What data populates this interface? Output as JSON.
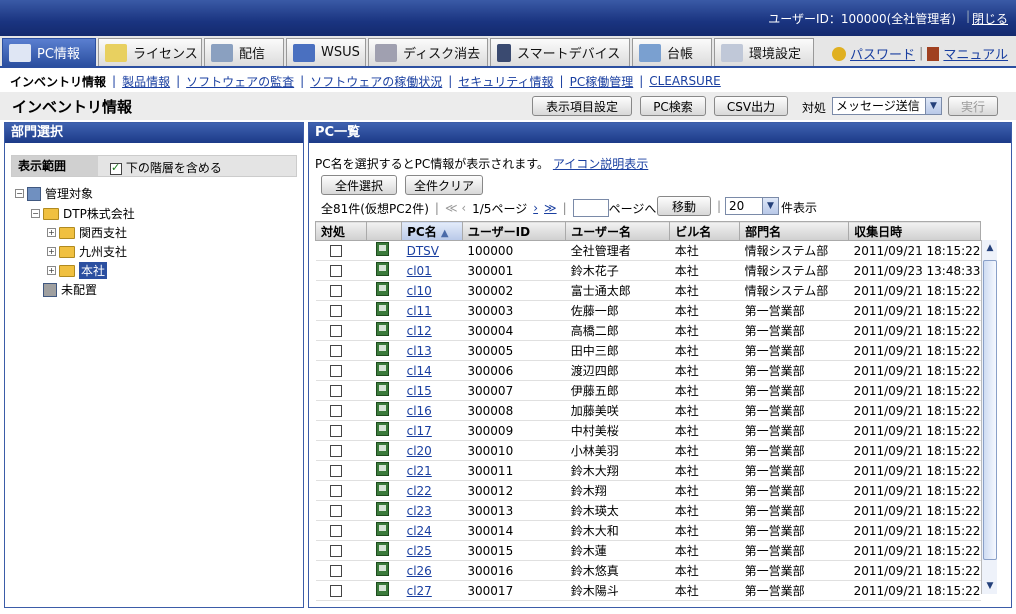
{
  "header": {
    "user": "ユーザーID：100000(全社管理者)",
    "logout": "閉じる"
  },
  "tabs": [
    {
      "label": "PC情報",
      "icon": "pc-info-icon"
    },
    {
      "label": "ライセンス",
      "icon": "license-icon"
    },
    {
      "label": "配信",
      "icon": "distribution-icon"
    },
    {
      "label": "WSUS",
      "icon": "wsus-icon"
    },
    {
      "label": "ディスク消去",
      "icon": "disk-erase-icon"
    },
    {
      "label": "スマートデバイス",
      "icon": "smart-device-icon"
    },
    {
      "label": "台帳",
      "icon": "ledger-icon"
    },
    {
      "label": "環境設定",
      "icon": "settings-icon"
    }
  ],
  "toplinks": {
    "password": "パスワード",
    "manual": "マニュアル"
  },
  "subnav": {
    "current": "インベントリ情報",
    "links": [
      "製品情報",
      "ソフトウェアの監査",
      "ソフトウェアの稼働状況",
      "セキュリティ情報",
      "PC稼働管理",
      "CLEARSURE"
    ]
  },
  "page": {
    "title": "インベントリ情報",
    "btn_columns": "表示項目設定",
    "btn_search": "PC検索",
    "btn_csv": "CSV出力",
    "action_label": "対処",
    "action_value": "メッセージ送信",
    "btn_exec": "実行"
  },
  "left": {
    "title": "部門選択",
    "scope_label": "表示範囲",
    "include_sub": "下の階層を含める",
    "tree": {
      "root": "管理対象",
      "company": "DTP株式会社",
      "branches": [
        "関西支社",
        "九州支社",
        "本社"
      ],
      "unassigned": "未配置"
    }
  },
  "right": {
    "title": "PC一覧",
    "info": "PC名を選択するとPC情報が表示されます。",
    "icon_help": "アイコン説明表示",
    "btn_select_all": "全件選択",
    "btn_clear_all": "全件クリア",
    "count": "全81件(仮想PC2件)",
    "pager": "1/5ページ",
    "page_goto_suffix": "ページへ",
    "btn_move": "移動",
    "per_page": "20",
    "per_page_suffix": "件表示",
    "columns": [
      "対処",
      "",
      "PC名",
      "ユーザーID",
      "ユーザー名",
      "ビル名",
      "部門名",
      "収集日時"
    ],
    "rows": [
      {
        "pc": "DTSV",
        "uid": "100000",
        "uname": "全社管理者",
        "bldg": "本社",
        "dept": "情報システム部",
        "date": "2011/09/21 18:15:22"
      },
      {
        "pc": "cl01",
        "uid": "300001",
        "uname": "鈴木花子",
        "bldg": "本社",
        "dept": "情報システム部",
        "date": "2011/09/23 13:48:33"
      },
      {
        "pc": "cl10",
        "uid": "300002",
        "uname": "富士通太郎",
        "bldg": "本社",
        "dept": "情報システム部",
        "date": "2011/09/21 18:15:22"
      },
      {
        "pc": "cl11",
        "uid": "300003",
        "uname": "佐藤一郎",
        "bldg": "本社",
        "dept": "第一営業部",
        "date": "2011/09/21 18:15:22"
      },
      {
        "pc": "cl12",
        "uid": "300004",
        "uname": "高橋二郎",
        "bldg": "本社",
        "dept": "第一営業部",
        "date": "2011/09/21 18:15:22"
      },
      {
        "pc": "cl13",
        "uid": "300005",
        "uname": "田中三郎",
        "bldg": "本社",
        "dept": "第一営業部",
        "date": "2011/09/21 18:15:22"
      },
      {
        "pc": "cl14",
        "uid": "300006",
        "uname": "渡辺四郎",
        "bldg": "本社",
        "dept": "第一営業部",
        "date": "2011/09/21 18:15:22"
      },
      {
        "pc": "cl15",
        "uid": "300007",
        "uname": "伊藤五郎",
        "bldg": "本社",
        "dept": "第一営業部",
        "date": "2011/09/21 18:15:22"
      },
      {
        "pc": "cl16",
        "uid": "300008",
        "uname": "加藤美咲",
        "bldg": "本社",
        "dept": "第一営業部",
        "date": "2011/09/21 18:15:22"
      },
      {
        "pc": "cl17",
        "uid": "300009",
        "uname": "中村美桜",
        "bldg": "本社",
        "dept": "第一営業部",
        "date": "2011/09/21 18:15:22"
      },
      {
        "pc": "cl20",
        "uid": "300010",
        "uname": "小林美羽",
        "bldg": "本社",
        "dept": "第一営業部",
        "date": "2011/09/21 18:15:22"
      },
      {
        "pc": "cl21",
        "uid": "300011",
        "uname": "鈴木大翔",
        "bldg": "本社",
        "dept": "第一営業部",
        "date": "2011/09/21 18:15:22"
      },
      {
        "pc": "cl22",
        "uid": "300012",
        "uname": "鈴木翔",
        "bldg": "本社",
        "dept": "第一営業部",
        "date": "2011/09/21 18:15:22"
      },
      {
        "pc": "cl23",
        "uid": "300013",
        "uname": "鈴木瑛太",
        "bldg": "本社",
        "dept": "第一営業部",
        "date": "2011/09/21 18:15:22"
      },
      {
        "pc": "cl24",
        "uid": "300014",
        "uname": "鈴木大和",
        "bldg": "本社",
        "dept": "第一営業部",
        "date": "2011/09/21 18:15:22"
      },
      {
        "pc": "cl25",
        "uid": "300015",
        "uname": "鈴木蓮",
        "bldg": "本社",
        "dept": "第一営業部",
        "date": "2011/09/21 18:15:22"
      },
      {
        "pc": "cl26",
        "uid": "300016",
        "uname": "鈴木悠真",
        "bldg": "本社",
        "dept": "第一営業部",
        "date": "2011/09/21 18:15:22"
      },
      {
        "pc": "cl27",
        "uid": "300017",
        "uname": "鈴木陽斗",
        "bldg": "本社",
        "dept": "第一営業部",
        "date": "2011/09/21 18:15:22"
      }
    ]
  }
}
